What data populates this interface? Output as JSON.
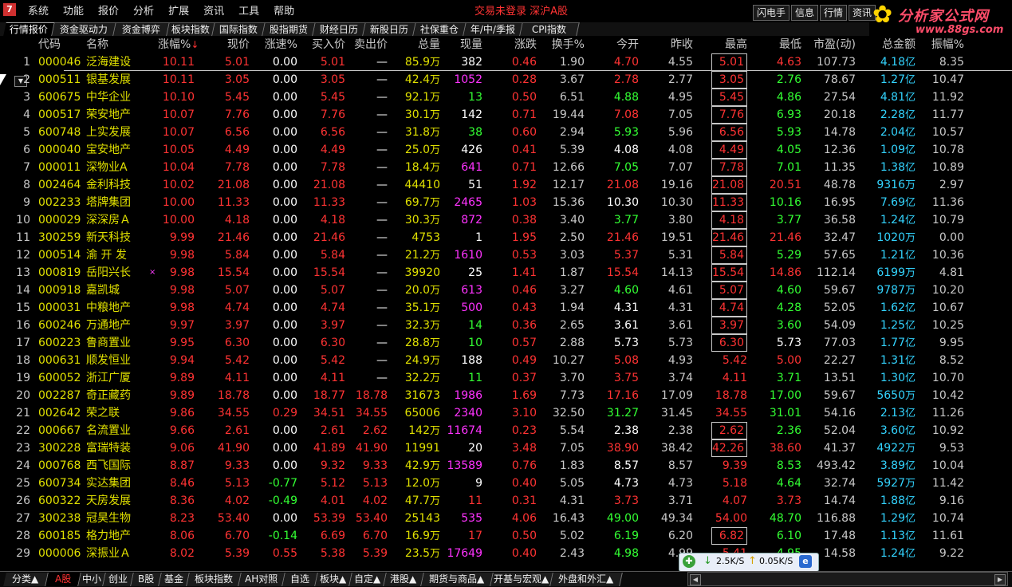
{
  "menu": [
    "系统",
    "功能",
    "报价",
    "分析",
    "扩展",
    "资讯",
    "工具",
    "帮助"
  ],
  "status_text": "交易未登录 深沪A股",
  "top_buttons": [
    "闪电手",
    "信息",
    "行情",
    "资讯"
  ],
  "brand": {
    "name": "分析家公式网",
    "url": "www.88gs.com"
  },
  "tabs": [
    "行情报价",
    "资金驱动力",
    "资金博弈",
    "板块指数",
    "国际指数",
    "股指期货",
    "财经日历",
    "新股日历",
    "社保重仓",
    "年/中/季报",
    "CPI指数"
  ],
  "headers": {
    "index": "",
    "code": "代码",
    "name": "名称",
    "chg": "涨幅%",
    "price": "现价",
    "speed": "涨速%",
    "buy": "买入价",
    "sell": "卖出价",
    "vol": "总量",
    "cur": "现量",
    "diff": "涨跌",
    "turn": "换手%",
    "open": "今开",
    "prev": "昨收",
    "high": "最高",
    "low": "最低",
    "pe": "市盈(动)",
    "amt": "总金额",
    "amp": "振幅%"
  },
  "rows": [
    {
      "i": "1",
      "code": "000046",
      "name": "泛海建设",
      "chg": "10.11",
      "price": "5.01",
      "speed": "0.00",
      "buy": "5.01",
      "sell": "—",
      "vol": "85.9",
      "volu": "万",
      "cur": "382",
      "curc": "white",
      "diff": "0.46",
      "turn": "1.90",
      "open": "4.70",
      "openc": "red",
      "prev": "4.55",
      "high": "5.01",
      "highc": "red",
      "low": "4.63",
      "lowc": "red",
      "pe": "107.73",
      "amt": "4.18",
      "amtu": "亿",
      "amp": "8.35"
    },
    {
      "i": "2",
      "code": "000511",
      "name": "银基发展",
      "chg": "10.11",
      "price": "3.05",
      "speed": "0.00",
      "buy": "3.05",
      "sell": "—",
      "vol": "42.4",
      "volu": "万",
      "cur": "1052",
      "curc": "mag",
      "diff": "0.28",
      "turn": "3.67",
      "open": "2.78",
      "openc": "red",
      "prev": "2.77",
      "high": "3.05",
      "highc": "red",
      "low": "2.76",
      "lowc": "green",
      "pe": "78.67",
      "amt": "1.27",
      "amtu": "亿",
      "amp": "10.47"
    },
    {
      "i": "3",
      "code": "600675",
      "name": "中华企业",
      "chg": "10.10",
      "price": "5.45",
      "speed": "0.00",
      "buy": "5.45",
      "sell": "—",
      "vol": "92.1",
      "volu": "万",
      "cur": "13",
      "curc": "green",
      "diff": "0.50",
      "turn": "6.51",
      "open": "4.88",
      "openc": "green",
      "prev": "4.95",
      "high": "5.45",
      "highc": "red",
      "low": "4.86",
      "lowc": "green",
      "pe": "27.54",
      "amt": "4.81",
      "amtu": "亿",
      "amp": "11.92"
    },
    {
      "i": "4",
      "code": "000517",
      "name": "荣安地产",
      "chg": "10.07",
      "price": "7.76",
      "speed": "0.00",
      "buy": "7.76",
      "sell": "—",
      "vol": "30.1",
      "volu": "万",
      "cur": "142",
      "curc": "white",
      "diff": "0.71",
      "turn": "19.44",
      "open": "7.08",
      "openc": "red",
      "prev": "7.05",
      "high": "7.76",
      "highc": "red",
      "low": "6.93",
      "lowc": "green",
      "pe": "20.18",
      "amt": "2.28",
      "amtu": "亿",
      "amp": "11.77"
    },
    {
      "i": "5",
      "code": "600748",
      "name": "上实发展",
      "chg": "10.07",
      "price": "6.56",
      "speed": "0.00",
      "buy": "6.56",
      "sell": "—",
      "vol": "31.8",
      "volu": "万",
      "cur": "38",
      "curc": "green",
      "diff": "0.60",
      "turn": "2.94",
      "open": "5.93",
      "openc": "green",
      "prev": "5.96",
      "high": "6.56",
      "highc": "red",
      "low": "5.93",
      "lowc": "green",
      "pe": "14.78",
      "amt": "2.04",
      "amtu": "亿",
      "amp": "10.57"
    },
    {
      "i": "6",
      "code": "000040",
      "name": "宝安地产",
      "chg": "10.05",
      "price": "4.49",
      "speed": "0.00",
      "buy": "4.49",
      "sell": "—",
      "vol": "25.0",
      "volu": "万",
      "cur": "426",
      "curc": "white",
      "diff": "0.41",
      "turn": "5.39",
      "open": "4.08",
      "openc": "white",
      "prev": "4.08",
      "high": "4.49",
      "highc": "red",
      "low": "4.05",
      "lowc": "green",
      "pe": "12.36",
      "amt": "1.09",
      "amtu": "亿",
      "amp": "10.78"
    },
    {
      "i": "7",
      "code": "000011",
      "name": "深物业A",
      "chg": "10.04",
      "price": "7.78",
      "speed": "0.00",
      "buy": "7.78",
      "sell": "—",
      "vol": "18.4",
      "volu": "万",
      "cur": "641",
      "curc": "mag",
      "diff": "0.71",
      "turn": "12.66",
      "open": "7.05",
      "openc": "green",
      "prev": "7.07",
      "high": "7.78",
      "highc": "red",
      "low": "7.01",
      "lowc": "green",
      "pe": "11.35",
      "amt": "1.38",
      "amtu": "亿",
      "amp": "10.89"
    },
    {
      "i": "8",
      "code": "002464",
      "name": "金利科技",
      "chg": "10.02",
      "price": "21.08",
      "speed": "0.00",
      "buy": "21.08",
      "sell": "—",
      "vol": "44410",
      "volu": "",
      "cur": "51",
      "curc": "white",
      "diff": "1.92",
      "turn": "12.17",
      "open": "21.08",
      "openc": "red",
      "prev": "19.16",
      "high": "21.08",
      "highc": "red",
      "low": "20.51",
      "lowc": "red",
      "pe": "48.78",
      "amt": "9316",
      "amtu": "万",
      "amp": "2.97"
    },
    {
      "i": "9",
      "code": "002233",
      "name": "塔牌集团",
      "chg": "10.00",
      "price": "11.33",
      "speed": "0.00",
      "buy": "11.33",
      "sell": "—",
      "vol": "69.7",
      "volu": "万",
      "cur": "2465",
      "curc": "mag",
      "diff": "1.03",
      "turn": "15.36",
      "open": "10.30",
      "openc": "white",
      "prev": "10.30",
      "high": "11.33",
      "highc": "red",
      "low": "10.16",
      "lowc": "green",
      "pe": "16.95",
      "amt": "7.69",
      "amtu": "亿",
      "amp": "11.36"
    },
    {
      "i": "10",
      "code": "000029",
      "name": "深深房Ａ",
      "chg": "10.00",
      "price": "4.18",
      "speed": "0.00",
      "buy": "4.18",
      "sell": "—",
      "vol": "30.3",
      "volu": "万",
      "cur": "872",
      "curc": "mag",
      "diff": "0.38",
      "turn": "3.40",
      "open": "3.77",
      "openc": "green",
      "prev": "3.80",
      "high": "4.18",
      "highc": "red",
      "low": "3.77",
      "lowc": "green",
      "pe": "36.58",
      "amt": "1.24",
      "amtu": "亿",
      "amp": "10.79"
    },
    {
      "i": "11",
      "code": "300259",
      "name": "新天科技",
      "chg": "9.99",
      "price": "21.46",
      "speed": "0.00",
      "buy": "21.46",
      "sell": "—",
      "vol": "4753",
      "volu": "",
      "cur": "1",
      "curc": "white",
      "diff": "1.95",
      "turn": "2.50",
      "open": "21.46",
      "openc": "red",
      "prev": "19.51",
      "high": "21.46",
      "highc": "red",
      "low": "21.46",
      "lowc": "red",
      "pe": "32.47",
      "amt": "1020",
      "amtu": "万",
      "amp": "0.00"
    },
    {
      "i": "12",
      "code": "000514",
      "name": "渝 开 发",
      "chg": "9.98",
      "price": "5.84",
      "speed": "0.00",
      "buy": "5.84",
      "sell": "—",
      "vol": "21.2",
      "volu": "万",
      "cur": "1610",
      "curc": "mag",
      "diff": "0.53",
      "turn": "3.03",
      "open": "5.37",
      "openc": "red",
      "prev": "5.31",
      "high": "5.84",
      "highc": "red",
      "low": "5.29",
      "lowc": "green",
      "pe": "57.65",
      "amt": "1.21",
      "amtu": "亿",
      "amp": "10.36"
    },
    {
      "i": "13",
      "code": "000819",
      "name": "岳阳兴长",
      "mark": "×",
      "chg": "9.98",
      "price": "15.54",
      "speed": "0.00",
      "buy": "15.54",
      "sell": "—",
      "vol": "39920",
      "volu": "",
      "cur": "25",
      "curc": "white",
      "diff": "1.41",
      "turn": "1.87",
      "open": "15.54",
      "openc": "red",
      "prev": "14.13",
      "high": "15.54",
      "highc": "red",
      "low": "14.86",
      "lowc": "red",
      "pe": "112.14",
      "amt": "6199",
      "amtu": "万",
      "amp": "4.81"
    },
    {
      "i": "14",
      "code": "000918",
      "name": "嘉凯城",
      "chg": "9.98",
      "price": "5.07",
      "speed": "0.00",
      "buy": "5.07",
      "sell": "—",
      "vol": "20.0",
      "volu": "万",
      "cur": "613",
      "curc": "mag",
      "diff": "0.46",
      "turn": "3.27",
      "open": "4.60",
      "openc": "green",
      "prev": "4.61",
      "high": "5.07",
      "highc": "red",
      "low": "4.60",
      "lowc": "green",
      "pe": "59.67",
      "amt": "9787",
      "amtu": "万",
      "amp": "10.20"
    },
    {
      "i": "15",
      "code": "000031",
      "name": "中粮地产",
      "chg": "9.98",
      "price": "4.74",
      "speed": "0.00",
      "buy": "4.74",
      "sell": "—",
      "vol": "35.1",
      "volu": "万",
      "cur": "500",
      "curc": "mag",
      "diff": "0.43",
      "turn": "1.94",
      "open": "4.31",
      "openc": "white",
      "prev": "4.31",
      "high": "4.74",
      "highc": "red",
      "low": "4.28",
      "lowc": "green",
      "pe": "52.05",
      "amt": "1.62",
      "amtu": "亿",
      "amp": "10.67"
    },
    {
      "i": "16",
      "code": "600246",
      "name": "万通地产",
      "chg": "9.97",
      "price": "3.97",
      "speed": "0.00",
      "buy": "3.97",
      "sell": "—",
      "vol": "32.3",
      "volu": "万",
      "cur": "14",
      "curc": "green",
      "diff": "0.36",
      "turn": "2.65",
      "open": "3.61",
      "openc": "white",
      "prev": "3.61",
      "high": "3.97",
      "highc": "red",
      "low": "3.60",
      "lowc": "green",
      "pe": "54.09",
      "amt": "1.25",
      "amtu": "亿",
      "amp": "10.25"
    },
    {
      "i": "17",
      "code": "600223",
      "name": "鲁商置业",
      "chg": "9.95",
      "price": "6.30",
      "speed": "0.00",
      "buy": "6.30",
      "sell": "—",
      "vol": "28.8",
      "volu": "万",
      "cur": "10",
      "curc": "green",
      "diff": "0.57",
      "turn": "2.88",
      "open": "5.73",
      "openc": "white",
      "prev": "5.73",
      "high": "6.30",
      "highc": "red",
      "low": "5.73",
      "lowc": "white",
      "pe": "77.03",
      "amt": "1.77",
      "amtu": "亿",
      "amp": "9.95"
    },
    {
      "i": "18",
      "code": "000631",
      "name": "顺发恒业",
      "chg": "9.94",
      "price": "5.42",
      "speed": "0.00",
      "buy": "5.42",
      "sell": "—",
      "vol": "24.9",
      "volu": "万",
      "cur": "188",
      "curc": "white",
      "diff": "0.49",
      "turn": "10.27",
      "open": "5.08",
      "openc": "red",
      "prev": "4.93",
      "high": "5.42",
      "highc": "red",
      "low": "5.00",
      "lowc": "red",
      "pe": "22.27",
      "amt": "1.31",
      "amtu": "亿",
      "amp": "8.52"
    },
    {
      "i": "19",
      "code": "600052",
      "name": "浙江广厦",
      "chg": "9.89",
      "price": "4.11",
      "speed": "0.00",
      "buy": "4.11",
      "sell": "—",
      "vol": "32.2",
      "volu": "万",
      "cur": "11",
      "curc": "green",
      "diff": "0.37",
      "turn": "3.70",
      "open": "3.75",
      "openc": "red",
      "prev": "3.74",
      "high": "4.11",
      "highc": "red",
      "low": "3.71",
      "lowc": "green",
      "pe": "13.51",
      "amt": "1.30",
      "amtu": "亿",
      "amp": "10.70"
    },
    {
      "i": "20",
      "code": "002287",
      "name": "奇正藏药",
      "chg": "9.89",
      "price": "18.78",
      "speed": "0.00",
      "buy": "18.77",
      "sell": "18.78",
      "vol": "31673",
      "volu": "",
      "cur": "1986",
      "curc": "mag",
      "diff": "1.69",
      "turn": "7.73",
      "open": "17.16",
      "openc": "red",
      "prev": "17.09",
      "high": "18.78",
      "highc": "red",
      "low": "17.00",
      "lowc": "green",
      "pe": "59.67",
      "amt": "5650",
      "amtu": "万",
      "amp": "10.42"
    },
    {
      "i": "21",
      "code": "002642",
      "name": "荣之联",
      "chg": "9.86",
      "price": "34.55",
      "speed": "0.29",
      "buy": "34.51",
      "sell": "34.55",
      "vol": "65006",
      "volu": "",
      "cur": "2340",
      "curc": "mag",
      "diff": "3.10",
      "turn": "32.50",
      "open": "31.27",
      "openc": "green",
      "prev": "31.45",
      "high": "34.55",
      "highc": "red",
      "low": "31.01",
      "lowc": "green",
      "pe": "54.16",
      "amt": "2.13",
      "amtu": "亿",
      "amp": "11.26"
    },
    {
      "i": "22",
      "code": "000667",
      "name": "名流置业",
      "chg": "9.66",
      "price": "2.61",
      "speed": "0.00",
      "buy": "2.61",
      "sell": "2.62",
      "vol": "142",
      "volu": "万",
      "cur": "11674",
      "curc": "mag",
      "diff": "0.23",
      "turn": "5.54",
      "open": "2.38",
      "openc": "white",
      "prev": "2.38",
      "high": "2.62",
      "highc": "red",
      "low": "2.36",
      "lowc": "green",
      "pe": "52.04",
      "amt": "3.60",
      "amtu": "亿",
      "amp": "10.92"
    },
    {
      "i": "23",
      "code": "300228",
      "name": "富瑞特装",
      "chg": "9.06",
      "price": "41.90",
      "speed": "0.00",
      "buy": "41.89",
      "sell": "41.90",
      "vol": "11991",
      "volu": "",
      "cur": "20",
      "curc": "white",
      "diff": "3.48",
      "turn": "7.05",
      "open": "38.90",
      "openc": "red",
      "prev": "38.42",
      "high": "42.26",
      "highc": "red",
      "low": "38.60",
      "lowc": "red",
      "pe": "41.37",
      "amt": "4922",
      "amtu": "万",
      "amp": "9.53"
    },
    {
      "i": "24",
      "code": "000768",
      "name": "西飞国际",
      "chg": "8.87",
      "price": "9.33",
      "speed": "0.00",
      "buy": "9.32",
      "sell": "9.33",
      "vol": "42.9",
      "volu": "万",
      "cur": "13589",
      "curc": "mag",
      "diff": "0.76",
      "turn": "1.83",
      "open": "8.57",
      "openc": "white",
      "prev": "8.57",
      "high": "9.39",
      "highc": "red",
      "low": "8.53",
      "lowc": "green",
      "pe": "493.42",
      "amt": "3.89",
      "amtu": "亿",
      "amp": "10.04"
    },
    {
      "i": "25",
      "code": "600734",
      "name": "实达集团",
      "chg": "8.46",
      "price": "5.13",
      "speed": "-0.77",
      "buy": "5.12",
      "sell": "5.13",
      "vol": "12.0",
      "volu": "万",
      "cur": "9",
      "curc": "white",
      "diff": "0.40",
      "turn": "5.05",
      "open": "4.73",
      "openc": "white",
      "prev": "4.73",
      "high": "5.18",
      "highc": "red",
      "low": "4.64",
      "lowc": "green",
      "pe": "32.74",
      "amt": "5927",
      "amtu": "万",
      "amp": "11.42"
    },
    {
      "i": "26",
      "code": "600322",
      "name": "天房发展",
      "chg": "8.36",
      "price": "4.02",
      "speed": "-0.49",
      "buy": "4.01",
      "sell": "4.02",
      "vol": "47.7",
      "volu": "万",
      "cur": "11",
      "curc": "red",
      "diff": "0.31",
      "turn": "4.31",
      "open": "3.73",
      "openc": "red",
      "prev": "3.71",
      "high": "4.07",
      "highc": "red",
      "low": "3.73",
      "lowc": "red",
      "pe": "14.74",
      "amt": "1.88",
      "amtu": "亿",
      "amp": "9.16"
    },
    {
      "i": "27",
      "code": "300238",
      "name": "冠昊生物",
      "chg": "8.23",
      "price": "53.40",
      "speed": "0.00",
      "buy": "53.39",
      "sell": "53.40",
      "vol": "25143",
      "volu": "",
      "cur": "535",
      "curc": "mag",
      "diff": "4.06",
      "turn": "16.43",
      "open": "49.00",
      "openc": "green",
      "prev": "49.34",
      "high": "54.00",
      "highc": "red",
      "low": "48.70",
      "lowc": "green",
      "pe": "116.88",
      "amt": "1.29",
      "amtu": "亿",
      "amp": "10.74"
    },
    {
      "i": "28",
      "code": "600185",
      "name": "格力地产",
      "chg": "8.06",
      "price": "6.70",
      "speed": "-0.14",
      "buy": "6.69",
      "sell": "6.70",
      "vol": "16.9",
      "volu": "万",
      "cur": "17",
      "curc": "red",
      "diff": "0.50",
      "turn": "5.02",
      "open": "6.19",
      "openc": "green",
      "prev": "6.20",
      "high": "6.82",
      "highc": "red",
      "low": "6.10",
      "lowc": "green",
      "pe": "17.48",
      "amt": "1.13",
      "amtu": "亿",
      "amp": "11.61"
    },
    {
      "i": "29",
      "code": "000006",
      "name": "深振业Ａ",
      "chg": "8.02",
      "price": "5.39",
      "speed": "0.55",
      "buy": "5.38",
      "sell": "5.39",
      "vol": "23.5",
      "volu": "万",
      "cur": "17649",
      "curc": "mag",
      "diff": "0.40",
      "turn": "2.43",
      "open": "4.98",
      "openc": "green",
      "prev": "4.99",
      "high": "5.41",
      "highc": "red",
      "low": "4.95",
      "lowc": "green",
      "pe": "14.58",
      "amt": "1.24",
      "amtu": "亿",
      "amp": "9.22"
    }
  ],
  "boxed_high_rows": [
    1,
    2,
    3,
    4,
    5,
    6,
    7,
    8,
    9,
    10,
    11,
    12,
    13,
    14,
    15,
    16,
    17,
    22,
    23,
    28
  ],
  "bottom_tabs": [
    "分类▲",
    "A股",
    "中小",
    "创业",
    "B股",
    "基金",
    "板块指数",
    "AH对照",
    "自选",
    "板块▲",
    "自定▲",
    "港股▲",
    "期货与商品▲",
    "开基与宏观▲",
    "外盘和外汇▲"
  ],
  "network": {
    "down": "2.5K/S",
    "up": "0.05K/S"
  },
  "colors": {
    "up": "#ff3333",
    "down": "#33ff33",
    "flat": "#ffffff",
    "amount": "#33d4ff",
    "volume": "#e0e000",
    "highlight": "#ff33ff"
  }
}
